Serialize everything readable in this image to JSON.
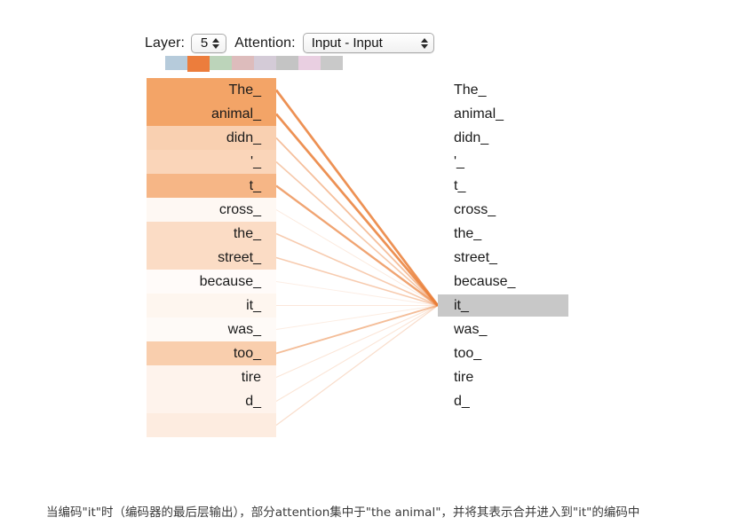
{
  "controls": {
    "layer_label": "Layer:",
    "layer_value": "5",
    "attention_label": "Attention:",
    "attention_value": "Input - Input"
  },
  "swatches": [
    {
      "name": "head-0",
      "color": "#b6cbdb"
    },
    {
      "name": "head-1",
      "color": "#ec7d3c"
    },
    {
      "name": "head-2",
      "color": "#bcd4ba"
    },
    {
      "name": "head-3",
      "color": "#ddbcbc"
    },
    {
      "name": "head-4",
      "color": "#d4cbd7"
    },
    {
      "name": "head-5",
      "color": "#c4c4c4"
    },
    {
      "name": "head-6",
      "color": "#e9cfe1"
    },
    {
      "name": "head-7",
      "color": "#c9c9c9"
    }
  ],
  "selected_swatch_index": 1,
  "left_tokens": [
    {
      "text": "The_",
      "weight": 0.78
    },
    {
      "text": "animal_",
      "weight": 0.78
    },
    {
      "text": "didn_",
      "weight": 0.4
    },
    {
      "text": "'_",
      "weight": 0.36
    },
    {
      "text": "t_",
      "weight": 0.62
    },
    {
      "text": "cross_",
      "weight": 0.06
    },
    {
      "text": "the_",
      "weight": 0.3
    },
    {
      "text": "street_",
      "weight": 0.3
    },
    {
      "text": "because_",
      "weight": 0.03
    },
    {
      "text": "it_",
      "weight": 0.08
    },
    {
      "text": "was_",
      "weight": 0.04
    },
    {
      "text": "too_",
      "weight": 0.42
    },
    {
      "text": "tire",
      "weight": 0.1
    },
    {
      "text": "d_",
      "weight": 0.1
    },
    {
      "text": "",
      "weight": 0.16
    }
  ],
  "right_tokens": [
    {
      "text": "The_",
      "selected": false
    },
    {
      "text": "animal_",
      "selected": false
    },
    {
      "text": "didn_",
      "selected": false
    },
    {
      "text": "'_",
      "selected": false
    },
    {
      "text": "t_",
      "selected": false
    },
    {
      "text": "cross_",
      "selected": false
    },
    {
      "text": "the_",
      "selected": false
    },
    {
      "text": "street_",
      "selected": false
    },
    {
      "text": "because_",
      "selected": false
    },
    {
      "text": "it_",
      "selected": true
    },
    {
      "text": "was_",
      "selected": false
    },
    {
      "text": "too_",
      "selected": false
    },
    {
      "text": "tire",
      "selected": false
    },
    {
      "text": "d_",
      "selected": false
    }
  ],
  "attention": {
    "target_token": "it_",
    "line_color": "#ea7f38",
    "highlight_color": "#c8c8c8",
    "heat_color": "#f08a3c",
    "edges": [
      {
        "from": "The_",
        "weight": 0.8
      },
      {
        "from": "animal_",
        "weight": 0.8
      },
      {
        "from": "didn_",
        "weight": 0.42
      },
      {
        "from": "'_",
        "weight": 0.34
      },
      {
        "from": "t_",
        "weight": 0.64
      },
      {
        "from": "cross_",
        "weight": 0.07
      },
      {
        "from": "the_",
        "weight": 0.32
      },
      {
        "from": "street_",
        "weight": 0.32
      },
      {
        "from": "because_",
        "weight": 0.04
      },
      {
        "from": "it_",
        "weight": 0.09
      },
      {
        "from": "was_",
        "weight": 0.05
      },
      {
        "from": "too_",
        "weight": 0.44
      },
      {
        "from": "tire",
        "weight": 0.11
      },
      {
        "from": "d_",
        "weight": 0.11
      },
      {
        "from": "",
        "weight": 0.17
      }
    ]
  },
  "caption": {
    "text": "当编码\"it\"时（编码器的最后层输出），部分attention集中于\"the animal\"，并将其表示合并进入到\"it\"的编码中"
  }
}
